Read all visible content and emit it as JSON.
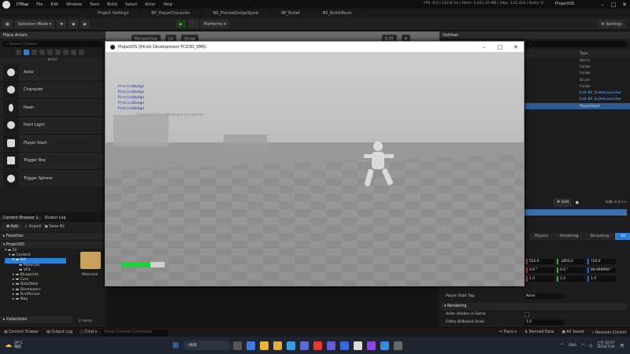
{
  "menubar": {
    "map_name": "ITMap",
    "items": [
      "File",
      "Edit",
      "Window",
      "Tools",
      "Build",
      "Select",
      "Actor",
      "Help"
    ],
    "stats": "FPS: 8.0 | 124.8 ms | Mem: 3,653.26 MB | Objs: 114,418 | Stalls: 0",
    "project": "ProjectDS"
  },
  "tabs": [
    {
      "label": "Project Settings"
    },
    {
      "label": "BP_PlayerCharacter"
    },
    {
      "label": "NS_PreciseDodgeSpark"
    },
    {
      "label": "BP_Bullet"
    },
    {
      "label": "NS_BulletBasic"
    }
  ],
  "toolbar": {
    "mode": "Selection Mode",
    "platforms": "Platforms",
    "settings": "Settings",
    "perspective": "Perspective",
    "lit": "Lit",
    "show": "Show",
    "snap_value": "0.25",
    "grid_value": "4"
  },
  "place_actors": {
    "title": "Place Actors",
    "search_placeholder": "Search Classes",
    "category": "BASIC",
    "items": [
      "Actor",
      "Character",
      "Pawn",
      "Point Light",
      "Player Start",
      "Trigger Box",
      "Trigger Sphere"
    ]
  },
  "content_browser": {
    "tab1": "Content Browser 1",
    "tab2": "Output Log",
    "add": "Add",
    "import": "Import",
    "save_all": "Save All",
    "favorites": "Favorites",
    "project": "ProjectDS",
    "tree": [
      "All",
      "Content",
      "Art",
      "Materials",
      "VFX",
      "Blueprints",
      "Core",
      "DataTable",
      "Developers",
      "FirstPerson",
      "Map"
    ],
    "collections": "Collections",
    "item_count": "2 items",
    "folder_label": "Materials"
  },
  "game_window": {
    "title": "ProjectDS (64-bit Development PCD3D_SM6)",
    "debug_lines": [
      "PreciseDodge",
      "PreciseDodge",
      "PreciseDodge",
      "PreciseDodge",
      "PreciseDodge"
    ],
    "faint_message": "DisableAllScreenMessages to suppress",
    "health_fraction": 0.68,
    "health_color": "#1ed33a"
  },
  "outliner": {
    "title": "Outliner",
    "type_header": "Type",
    "rows": [
      {
        "type": "World",
        "style": "plain"
      },
      {
        "type": "Folder",
        "style": "plain"
      },
      {
        "type": "Folder",
        "style": "plain"
      },
      {
        "type": "Brush",
        "style": "plain"
      },
      {
        "type": "Folder",
        "style": "plain"
      },
      {
        "type": "Edit BP_BulletLauncher",
        "style": "link"
      },
      {
        "type": "Edit BP_BulletLauncher",
        "style": "link"
      },
      {
        "type": "PlayerStart",
        "style": "sel"
      }
    ]
  },
  "details": {
    "add": "Add",
    "edit_cpp": "Edit in C++",
    "tabs": [
      "Physics",
      "Rendering",
      "Streaming",
      "All"
    ],
    "location": [
      "520.0",
      "-2850.0",
      "720.0"
    ],
    "rotation": [
      "0.0 °",
      "0.0 °",
      "89.999999 °"
    ],
    "scale": [
      "1.0",
      "1.0",
      "1.0"
    ],
    "player_start_tag_label": "Player Start Tag",
    "player_start_tag_value": "None",
    "section_rendering": "Rendering",
    "hidden_in_game": "Actor Hidden in Game",
    "billboard_scale_label": "Editor Billboard Scale",
    "billboard_scale_value": "1.0"
  },
  "statusbar": {
    "content_drawer": "Content Drawer",
    "output_log": "Output Log",
    "cmd": "Cmd",
    "console_placeholder": "Enter Console Command",
    "trace": "Trace",
    "derived_data": "Derived Data",
    "all_saved": "All Saved",
    "revision_control": "Revision Control"
  },
  "taskbar": {
    "weather_temp": "29°C",
    "weather_desc": "晴朗",
    "search": "搜尋",
    "lang": "ENG",
    "time": "上午 02:07",
    "date": "2024/7/26"
  },
  "colors": {
    "accent": "#2b7fd6",
    "selected_row": "#2f5a92"
  }
}
